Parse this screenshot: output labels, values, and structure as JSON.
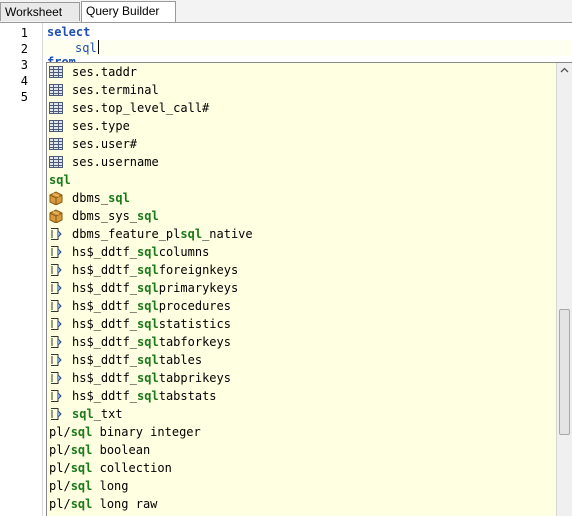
{
  "tabs": [
    {
      "label": "Worksheet"
    },
    {
      "label": "Query Builder"
    }
  ],
  "editor": {
    "line_numbers": [
      "1",
      "2",
      "3",
      "4",
      "5"
    ],
    "line1": "select",
    "line2": "sql",
    "line3_partial": "from"
  },
  "popup": {
    "items_top": [
      {
        "text": "ses.taddr",
        "icon": "table-column-icon"
      },
      {
        "text": "ses.terminal",
        "icon": "table-column-icon"
      },
      {
        "text": "ses.top_level_call#",
        "icon": "table-column-icon"
      },
      {
        "text": "ses.type",
        "icon": "table-column-icon"
      },
      {
        "text": "ses.user#",
        "icon": "table-column-icon"
      },
      {
        "text": "ses.username",
        "icon": "table-column-icon"
      }
    ],
    "group_header": "sql",
    "items_sql": [
      {
        "pre": "dbms_",
        "hl": "sql",
        "post": "",
        "icon": "package-icon"
      },
      {
        "pre": "dbms_sys_",
        "hl": "sql",
        "post": "",
        "icon": "package-icon"
      },
      {
        "pre": "dbms_feature_pl",
        "hl": "sql",
        "post": "_native",
        "icon": "view-icon"
      },
      {
        "pre": "hs$_ddtf_",
        "hl": "sql",
        "post": "columns",
        "icon": "view-icon"
      },
      {
        "pre": "hs$_ddtf_",
        "hl": "sql",
        "post": "foreignkeys",
        "icon": "view-icon"
      },
      {
        "pre": "hs$_ddtf_",
        "hl": "sql",
        "post": "primarykeys",
        "icon": "view-icon"
      },
      {
        "pre": "hs$_ddtf_",
        "hl": "sql",
        "post": "procedures",
        "icon": "view-icon"
      },
      {
        "pre": "hs$_ddtf_",
        "hl": "sql",
        "post": "statistics",
        "icon": "view-icon"
      },
      {
        "pre": "hs$_ddtf_",
        "hl": "sql",
        "post": "tabforkeys",
        "icon": "view-icon"
      },
      {
        "pre": "hs$_ddtf_",
        "hl": "sql",
        "post": "tables",
        "icon": "view-icon"
      },
      {
        "pre": "hs$_ddtf_",
        "hl": "sql",
        "post": "tabprikeys",
        "icon": "view-icon"
      },
      {
        "pre": "hs$_ddtf_",
        "hl": "sql",
        "post": "tabstats",
        "icon": "view-icon"
      },
      {
        "pre": "",
        "hl": "sql",
        "post": "_txt",
        "icon": "view-icon"
      }
    ],
    "items_plain": [
      {
        "pre": "pl/",
        "hl": "sql",
        "post": " binary integer"
      },
      {
        "pre": "pl/",
        "hl": "sql",
        "post": " boolean"
      },
      {
        "pre": "pl/",
        "hl": "sql",
        "post": " collection"
      },
      {
        "pre": "pl/",
        "hl": "sql",
        "post": " long"
      },
      {
        "pre": "pl/",
        "hl": "sql",
        "post": " long raw"
      }
    ]
  },
  "colors": {
    "popup_bg": "#ffffe2",
    "keyword": "#1f4fb0",
    "match_highlight": "#1a7a1a"
  }
}
